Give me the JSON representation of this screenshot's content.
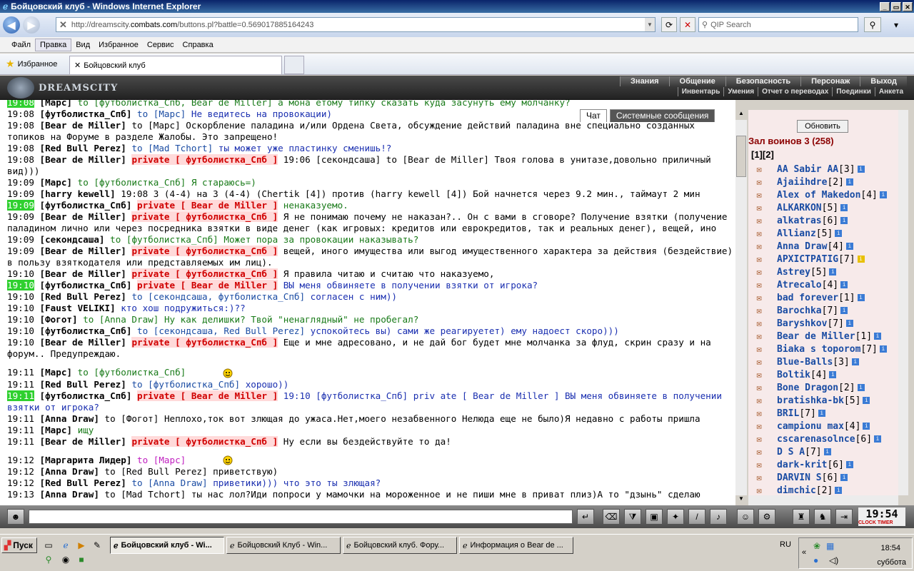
{
  "window": {
    "title": "Бойцовский клуб - Windows Internet Explorer"
  },
  "address": {
    "url_prefix": "http://dreamscity.",
    "url_domain": "combats.com",
    "url_rest": "/buttons.pl?battle=0.569017885164243",
    "search_placeholder": "QIP Search"
  },
  "menu": [
    "Файл",
    "Правка",
    "Вид",
    "Избранное",
    "Сервис",
    "Справка"
  ],
  "favorites": {
    "label": "Избранное",
    "tab_title": "Бойцовский клуб"
  },
  "game": {
    "logo": "DREAMSCITY",
    "topnav": [
      "Знания",
      "Общение",
      "Безопасность",
      "Персонаж",
      "Выход"
    ],
    "subnav": [
      "Инвентарь",
      "Умения",
      "Отчет о переводах",
      "Поединки",
      "Анкета"
    ]
  },
  "chat_tabs": {
    "chat": "Чат",
    "system": "Системные сообщения"
  },
  "chat": [
    {
      "ts": "19:08",
      "hl": true,
      "nick": "[Марс]",
      "to": "to [футболистка_Спб, Bear de Miller]",
      "to_cls": "green",
      "txt": "а мона етому типку сказать куда засунуть ему молчанку?",
      "txt_cls": "green"
    },
    {
      "ts": "19:08",
      "nick": "[футболистка_Спб]",
      "to": "to [Марс]",
      "txt": "Не ведитесь на провокации)",
      "txt_cls": "blue"
    },
    {
      "ts": "19:08",
      "nick": "[Bear de Miller]",
      "to": "to [Марс]",
      "to_cls": "black",
      "txt": "Оскорбление паладина и/или Ордена Света, обсуждение действий паладина вне специально созданных топиков на Форуме в разделе Жалобы. Это запрещено!"
    },
    {
      "ts": "19:08",
      "nick": "[Red Bull Perez]",
      "to": "to [Mad Tchort]",
      "txt": "ты может уже пластинку сменишь!?",
      "txt_cls": "blue"
    },
    {
      "ts": "19:08",
      "nick": "[Bear de Miller]",
      "private": "private [ футболистка_Спб ]",
      "txt": "19:06 [секондсаша] to [Bear de Miller] Твоя голова в унитазе,довольно приличный вид)))"
    },
    {
      "ts": "19:09",
      "nick": "[Марс]",
      "to": "to [футболистка_Спб]",
      "to_cls": "green",
      "txt": "Я стараюсь=)",
      "txt_cls": "green"
    },
    {
      "ts": "19:09",
      "nick": "[harry kewell]",
      "txt": "19:08 3 (4-4) на 3 (4-4) (Chertik [4]) против (harry kewell [4]) Бой начнется через 9.2 мин., таймаут 2 мин"
    },
    {
      "ts": "19:09",
      "hl": true,
      "nick": "[футболистка_Спб]",
      "private": "private [ Bear de Miller ]",
      "txt": "ненаказуемо.",
      "txt_cls": "green"
    },
    {
      "ts": "19:09",
      "nick": "[Bear de Miller]",
      "private": "private [ футболистка_Спб ]",
      "txt": "Я не понимаю почему не наказан?.. Он с вами в сговоре? Получение взятки (получение паладином лично или через посредника взятки в виде денег (как игровых: кредитов или еврокредитов, так и реальных денег), вещей, ино"
    },
    {
      "ts": "19:09",
      "nick": "[секондсаша]",
      "to": "to [футболистка_Спб]",
      "to_cls": "green",
      "txt": "Может пора за провокации наказывать?",
      "txt_cls": "green"
    },
    {
      "ts": "19:09",
      "nick": "[Bear de Miller]",
      "private": "private [ футболистка_Спб ]",
      "txt": "вещей, иного имущества или выгод имущественного характера за действия (бездействие) в пользу взяткодателя или представляемых им лиц)."
    },
    {
      "ts": "19:10",
      "nick": "[Bear de Miller]",
      "private": "private [ футболистка_Спб ]",
      "txt": "Я правила читаю и считаю что наказуемо,"
    },
    {
      "ts": "19:10",
      "hl": true,
      "nick": "[футболистка_Спб]",
      "private": "private [ Bear de Miller ]",
      "txt": "ВЫ меня обвиняете в получении взятки от игрока?",
      "txt_cls": "blue"
    },
    {
      "ts": "19:10",
      "nick": "[Red Bull Perez]",
      "to": "to [секондсаша, футболистка_Спб]",
      "txt": "согласен с ним))",
      "txt_cls": "blue"
    },
    {
      "ts": "19:10",
      "nick": "[Faust VELIKI]",
      "txt": "кто хош подружиться:)??",
      "txt_cls": "blue"
    },
    {
      "ts": "19:10",
      "nick": "[Фогот]",
      "to": "to [Anna Draw]",
      "to_cls": "green",
      "txt": "Ну как делишки? Твой \"ненаглядный\" не пробегал?",
      "txt_cls": "green"
    },
    {
      "ts": "19:10",
      "nick": "[футболистка_Спб]",
      "to": "to [секондсаша, Red Bull Perez]",
      "txt": "успокойтесь вы) сами же реагируетет) ему надоест скоро)))",
      "txt_cls": "blue"
    },
    {
      "ts": "19:10",
      "nick": "[Bear de Miller]",
      "private": "private [ футболистка_Спб ]",
      "txt": "Еще и мне адресовано, и не дай бог будет мне молчанка за флуд, скрин сразу и на форум.. Предупреждаю."
    },
    {
      "ts": "19:11",
      "gap": true,
      "nick": "[Марс]",
      "to": "to [футболистка_Спб]",
      "to_cls": "green",
      "txt": "",
      "smiley": true
    },
    {
      "ts": "19:11",
      "nick": "[Red Bull Perez]",
      "to": "to [футболистка_Спб]",
      "txt": "хорошо))",
      "txt_cls": "blue"
    },
    {
      "ts": "19:11",
      "hl": true,
      "nick": "[футболистка_Спб]",
      "private": "private [ Bear de Miller ]",
      "txt": "19:10 [футболистка_Спб] priv ate [ Bear de Miller ] ВЫ меня обвиняете в получении взятки от игрока?",
      "txt_cls": "blue"
    },
    {
      "ts": "19:11",
      "nick": "[Anna Draw]",
      "to": "to [Фогот]",
      "to_cls": "black",
      "txt": "Неплохо,ток вот злющая до ужаса.Нет,моего незабвенного Нелюда еще не было)Я недавно с работы пришла"
    },
    {
      "ts": "19:11",
      "nick": "[Марс]",
      "txt": "ищу",
      "txt_cls": "green"
    },
    {
      "ts": "19:11",
      "nick": "[Bear de Miller]",
      "private": "private [ футболистка_Спб ]",
      "txt": "Ну если вы бездействуйте то да!"
    },
    {
      "ts": "19:12",
      "gap": true,
      "nick": "[Маргарита Лидер]",
      "to": "to [Марс]",
      "to_cls": "magenta",
      "txt": "",
      "smiley": true
    },
    {
      "ts": "19:12",
      "nick": "[Anna Draw]",
      "to": "to [Red Bull Perez]",
      "to_cls": "black",
      "txt": "приветствую)"
    },
    {
      "ts": "19:12",
      "nick": "[Red Bull Perez]",
      "to": "to [Anna Draw]",
      "txt": "приветики))) что это ты злющая?",
      "txt_cls": "blue"
    },
    {
      "ts": "19:13",
      "nick": "[Anna Draw]",
      "to": "to [Mad Tchort]",
      "to_cls": "black",
      "txt": "ты нас лол?Иди попроси у мамочки на мороженное и не пиши мне в приват плиз)А то \"дзынь\" сделаю"
    }
  ],
  "users_panel": {
    "refresh": "Обновить",
    "hall": "Зал воинов 3 (258)",
    "pages": "[1][2]",
    "users": [
      {
        "name": "AA Sabir AA",
        "lvl": "[3]"
      },
      {
        "name": "Ajaiihdre",
        "lvl": "[2]"
      },
      {
        "name": "Alex of Makedon",
        "lvl": "[4]"
      },
      {
        "name": "ALKARKON",
        "lvl": "[5]"
      },
      {
        "name": "alkatras",
        "lvl": "[6]"
      },
      {
        "name": "Allianz",
        "lvl": "[5]"
      },
      {
        "name": "Anna Draw",
        "lvl": "[4]"
      },
      {
        "name": "АРХICTPATIG",
        "lvl": "[7]",
        "yinfo": true
      },
      {
        "name": "Astrey",
        "lvl": "[5]"
      },
      {
        "name": "Atrecalo",
        "lvl": "[4]"
      },
      {
        "name": "bad forever",
        "lvl": "[1]"
      },
      {
        "name": "Barochka",
        "lvl": "[7]"
      },
      {
        "name": "Baryshkov",
        "lvl": "[7]"
      },
      {
        "name": "Bear de Miller",
        "lvl": "[1]"
      },
      {
        "name": "Biaka s toporom",
        "lvl": "[7]"
      },
      {
        "name": "Blue-Balls",
        "lvl": "[3]"
      },
      {
        "name": "Boltik",
        "lvl": "[4]"
      },
      {
        "name": "Bone Dragon",
        "lvl": "[2]"
      },
      {
        "name": "bratishka-bk",
        "lvl": "[5]"
      },
      {
        "name": "BRIL",
        "lvl": "[7]"
      },
      {
        "name": "campionu max",
        "lvl": "[4]"
      },
      {
        "name": "cscarenasolnce",
        "lvl": "[6]"
      },
      {
        "name": "D S A",
        "lvl": "[7]"
      },
      {
        "name": "dark-krit",
        "lvl": "[6]"
      },
      {
        "name": "DARVIN S",
        "lvl": "[6]"
      },
      {
        "name": "dimchic",
        "lvl": "[2]"
      }
    ]
  },
  "clock": {
    "time": "19:54",
    "labels": "CLOCK TIMER"
  },
  "taskbar": {
    "start": "Пуск",
    "tasks": [
      "Бойцовский клуб - Wi...",
      "Бойцовский Клуб - Win...",
      "Бойцовский клуб. Фору...",
      "Информация о Bear de ..."
    ],
    "lang": "RU",
    "time": "18:54",
    "day": "суббота"
  }
}
